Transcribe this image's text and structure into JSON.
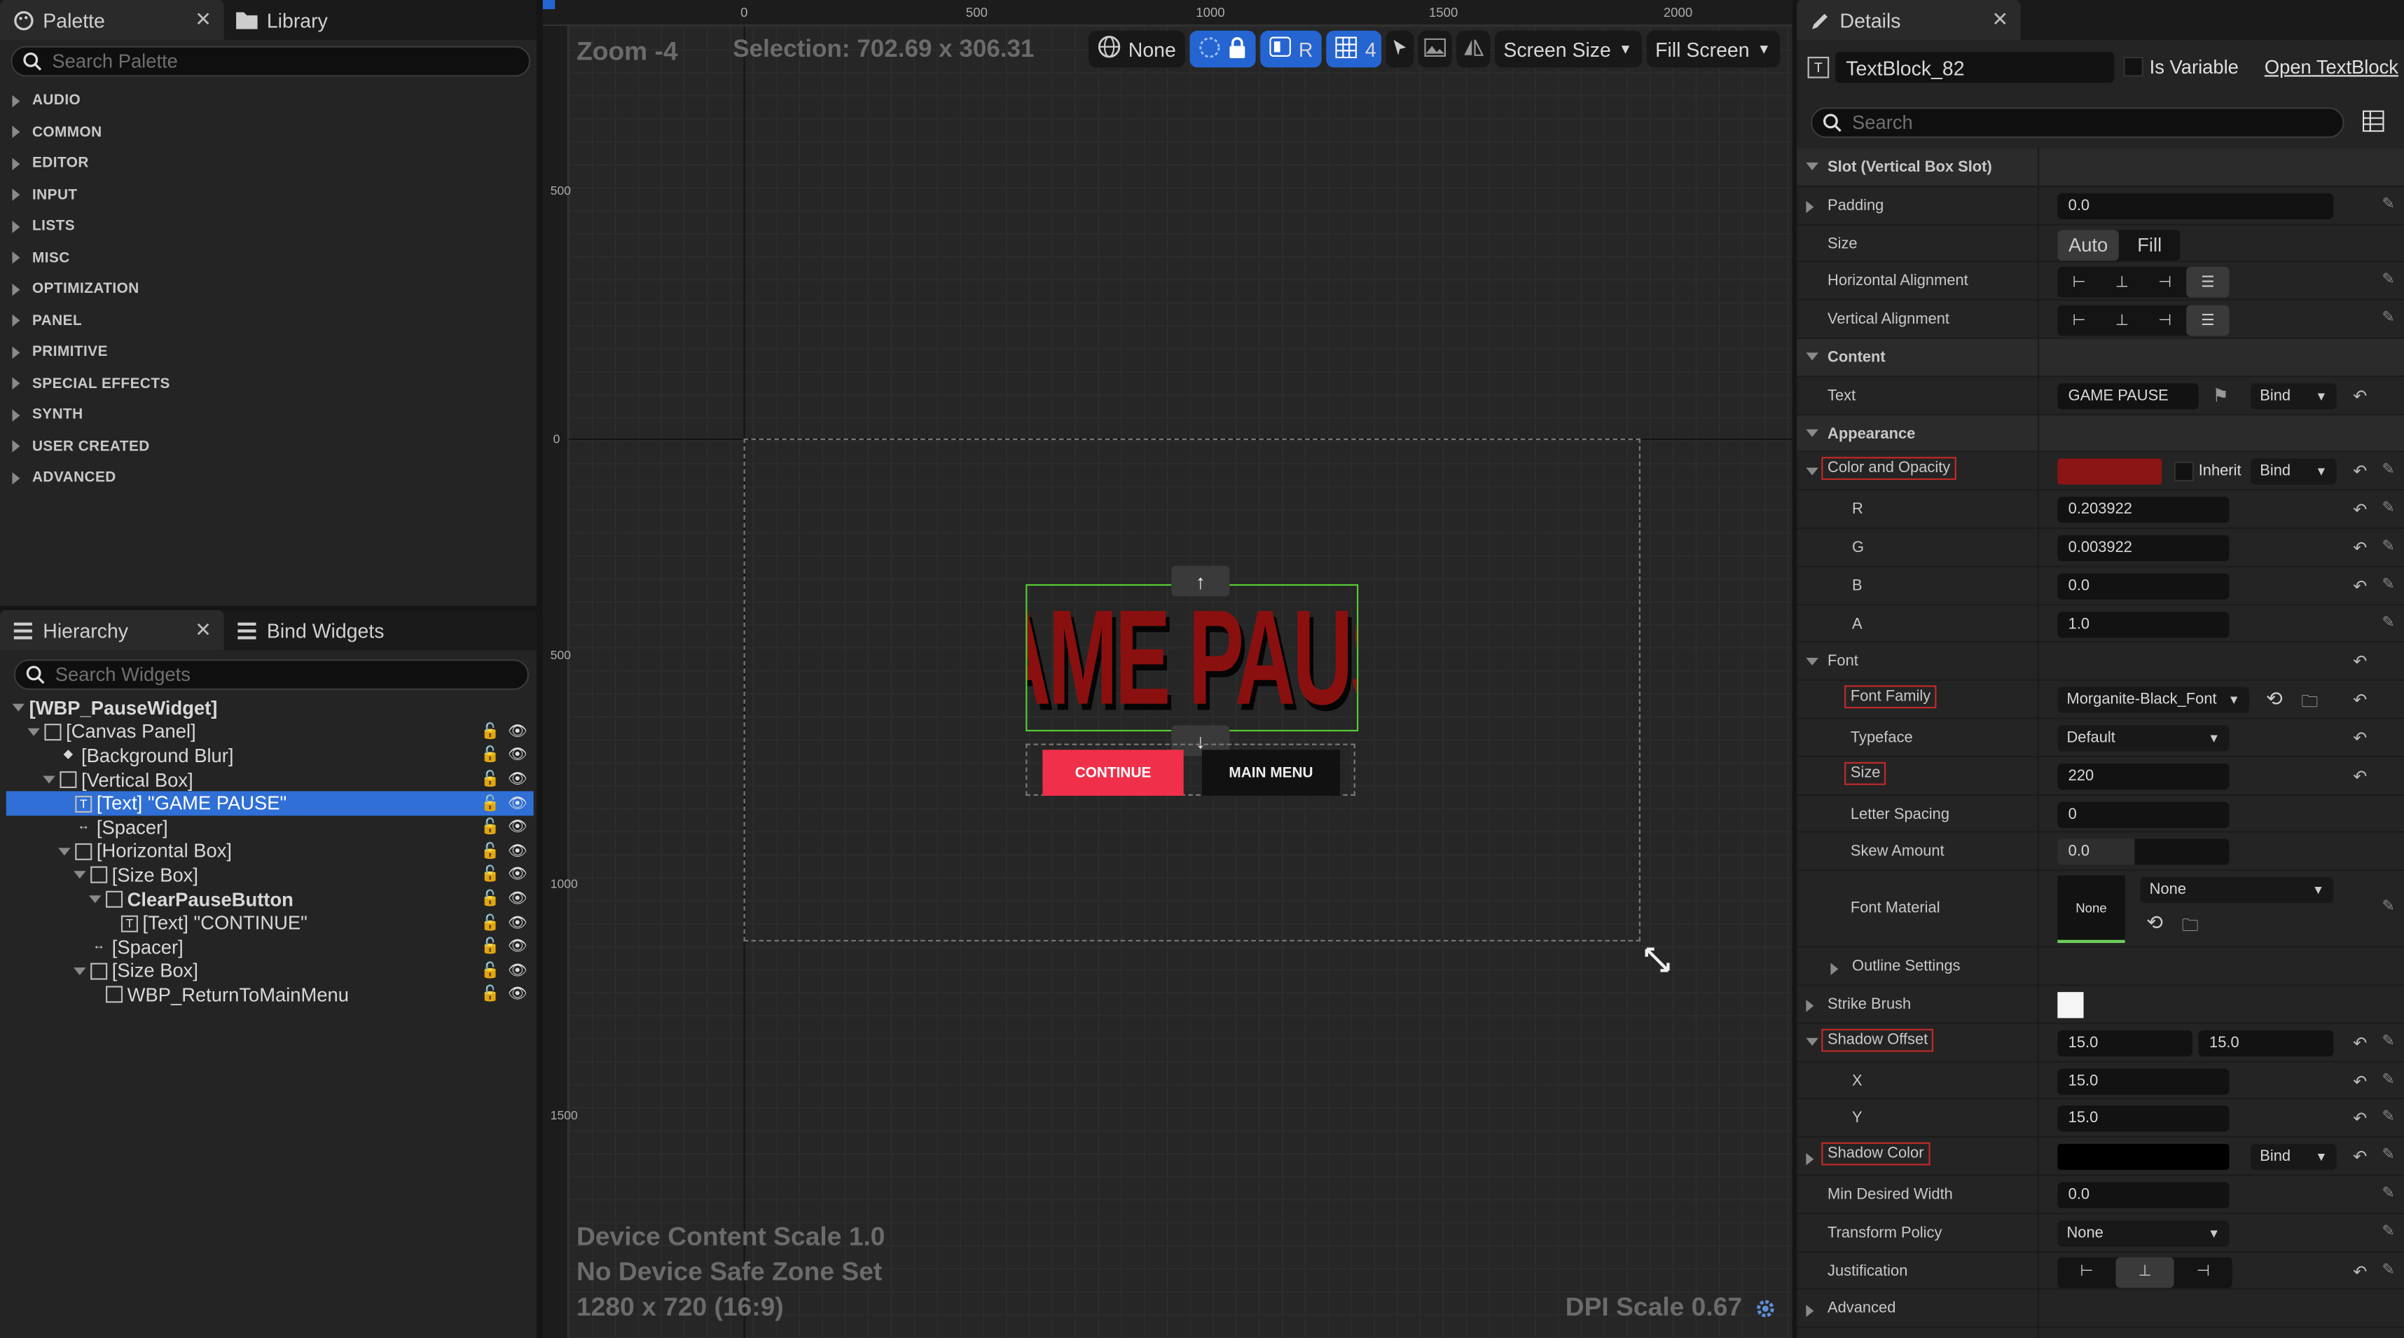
{
  "palette": {
    "tab_label": "Palette",
    "tab2_label": "Library",
    "search_placeholder": "Search Palette",
    "categories": [
      "AUDIO",
      "COMMON",
      "EDITOR",
      "INPUT",
      "LISTS",
      "MISC",
      "OPTIMIZATION",
      "PANEL",
      "PRIMITIVE",
      "SPECIAL EFFECTS",
      "SYNTH",
      "USER CREATED",
      "ADVANCED"
    ]
  },
  "hierarchy": {
    "tab_label": "Hierarchy",
    "tab2_label": "Bind Widgets",
    "search_placeholder": "Search Widgets",
    "items": [
      {
        "label": "[WBP_PauseWidget]",
        "depth": 0
      },
      {
        "label": "[Canvas Panel]",
        "depth": 1
      },
      {
        "label": "[Background Blur]",
        "depth": 2
      },
      {
        "label": "[Vertical Box]",
        "depth": 2
      },
      {
        "label": "[Text] \"GAME PAUSE\"",
        "depth": 3
      },
      {
        "label": "[Spacer]",
        "depth": 3
      },
      {
        "label": "[Horizontal Box]",
        "depth": 3
      },
      {
        "label": "[Size Box]",
        "depth": 4
      },
      {
        "label": "ClearPauseButton",
        "depth": 5
      },
      {
        "label": "[Text] \"CONTINUE\"",
        "depth": 6
      },
      {
        "label": "[Spacer]",
        "depth": 4
      },
      {
        "label": "[Size Box]",
        "depth": 4
      },
      {
        "label": "WBP_ReturnToMainMenu",
        "depth": 5
      }
    ]
  },
  "viewport": {
    "zoom": "Zoom -4",
    "selection": "Selection: 702.69 x 306.31",
    "toolbar": {
      "none_label": "None",
      "r_label": "R",
      "grid_num": "4",
      "screen_size": "Screen Size",
      "fill_screen": "Fill Screen"
    },
    "ruler_top": [
      "0",
      "500",
      "1000",
      "1500",
      "2000"
    ],
    "ruler_left": [
      "500",
      "0",
      "500",
      "1000",
      "1500"
    ],
    "content_scale": "Device Content Scale 1.0",
    "safe_zone": "No Device Safe Zone Set",
    "resolution": "1280 x 720 (16:9)",
    "dpi": "DPI Scale 0.67",
    "title_text": "GAME PAUSE",
    "continue_label": "CONTINUE",
    "main_menu_label": "MAIN MENU"
  },
  "details": {
    "tab_label": "Details",
    "widget_name": "TextBlock_82",
    "is_variable": "Is Variable",
    "open_link": "Open TextBlock",
    "search_placeholder": "Search",
    "slot_section": "Slot (Vertical Box Slot)",
    "padding_label": "Padding",
    "padding_value": "0.0",
    "size_label": "Size",
    "size_auto": "Auto",
    "size_fill": "Fill",
    "halign_label": "Horizontal Alignment",
    "valign_label": "Vertical Alignment",
    "content_section": "Content",
    "text_label": "Text",
    "text_value": "GAME PAUSE",
    "bind": "Bind",
    "appearance_section": "Appearance",
    "color_label": "Color and Opacity",
    "inherit": "Inherit",
    "color_swatch": "#8b1414",
    "r_label": "R",
    "r_value": "0.203922",
    "g_label": "G",
    "g_value": "0.003922",
    "b_label": "B",
    "b_value": "0.0",
    "a_label": "A",
    "a_value": "1.0",
    "font_section": "Font",
    "font_family_label": "Font Family",
    "font_family_value": "Morganite-Black_Font",
    "typeface_label": "Typeface",
    "typeface_value": "Default",
    "size2_label": "Size",
    "size2_value": "220",
    "letter_spacing_label": "Letter Spacing",
    "letter_spacing_value": "0",
    "skew_label": "Skew Amount",
    "skew_value": "0.0",
    "font_material_label": "Font Material",
    "font_material_thumb": "None",
    "font_material_value": "None",
    "outline_label": "Outline Settings",
    "strike_label": "Strike Brush",
    "shadow_offset_label": "Shadow Offset",
    "shadow_offset_x": "15.0",
    "shadow_offset_y": "15.0",
    "x_label": "X",
    "x_value": "15.0",
    "y_label": "Y",
    "y_value": "15.0",
    "shadow_color_label": "Shadow Color",
    "min_width_label": "Min Desired Width",
    "min_width_value": "0.0",
    "transform_policy_label": "Transform Policy",
    "transform_policy_value": "None",
    "justification_label": "Justification",
    "advanced_label": "Advanced"
  }
}
